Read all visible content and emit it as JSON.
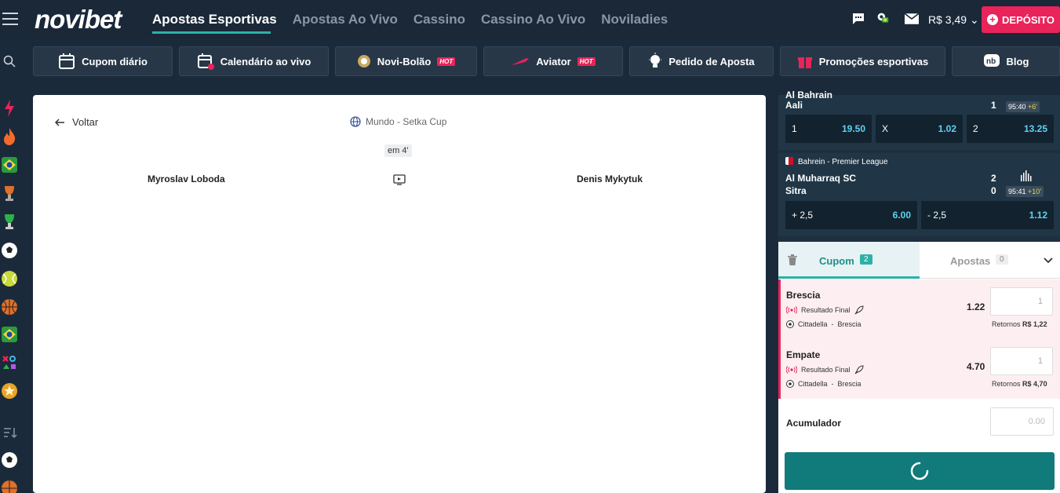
{
  "header": {
    "logo": "novibet",
    "nav": [
      "Apostas Esportivas",
      "Apostas Ao Vivo",
      "Cassino",
      "Cassino Ao Vivo",
      "Noviladies"
    ],
    "balance": "R$ 3,49",
    "deposit_label": "DEPÓSITO"
  },
  "promos": [
    {
      "label": "Cupom diário",
      "icon": "calendar-icon"
    },
    {
      "label": "Calendário ao vivo",
      "icon": "live-calendar-icon"
    },
    {
      "label": "Novi-Bolão",
      "icon": "trophy-icon",
      "badge": "HOT"
    },
    {
      "label": "Aviator",
      "icon": "aviator-icon",
      "badge": "HOT"
    },
    {
      "label": "Pedido de Aposta",
      "icon": "lightbulb-icon"
    },
    {
      "label": "Promoções esportivas",
      "icon": "gift-icon"
    },
    {
      "label": "Blog",
      "icon": "blog-icon"
    }
  ],
  "event": {
    "back_label": "Voltar",
    "league": "Mundo - Setka Cup",
    "status": "em 4'",
    "home": "Myroslav Loboda",
    "away": "Denis Mykytuk"
  },
  "live_matches": [
    {
      "league_partial": "Al Bahrain",
      "team2": "Aali",
      "score2": "1",
      "clock": "95:40",
      "added": "+6'",
      "odds": [
        {
          "label": "1",
          "value": "19.50"
        },
        {
          "label": "X",
          "value": "1.02"
        },
        {
          "label": "2",
          "value": "13.25"
        }
      ]
    },
    {
      "league": "Bahrein - Premier League",
      "team1": "Al Muharraq SC",
      "team2": "Sitra",
      "score1": "2",
      "score2": "0",
      "clock": "95:41",
      "added": "+10'",
      "odds": [
        {
          "label": "+ 2,5",
          "value": "6.00"
        },
        {
          "label": "- 2,5",
          "value": "1.12"
        }
      ]
    }
  ],
  "coupon": {
    "tab_cupom": "Cupom",
    "cupom_count": "2",
    "tab_apostas": "Apostas",
    "apostas_count": "0",
    "bets": [
      {
        "selection": "Brescia",
        "market": "Resultado Final",
        "teams": "Cittadella  -  Brescia",
        "odd": "1.22",
        "stake_placeholder": "1",
        "returns_label": "Retornos",
        "returns": "R$ 1,22"
      },
      {
        "selection": "Empate",
        "market": "Resultado Final",
        "teams": "Cittadella  -  Brescia",
        "odd": "4.70",
        "stake_placeholder": "1",
        "returns_label": "Retornos",
        "returns": "R$ 4,70"
      }
    ],
    "accumulator_label": "Acumulador",
    "accumulator_value": "0.00"
  },
  "colors": {
    "brand": "#2bb2a7",
    "accent": "#e8245a",
    "odds": "#5fd3f3"
  }
}
